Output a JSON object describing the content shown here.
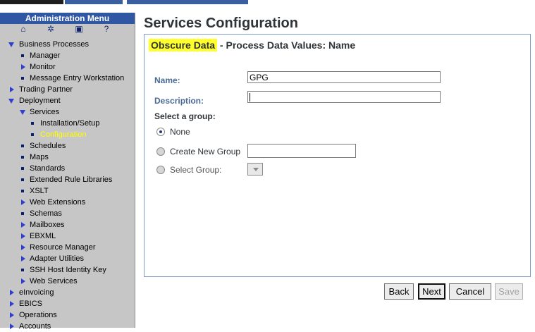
{
  "sidebar": {
    "title": "Administration Menu",
    "icons": [
      "home-icon",
      "globe-icon",
      "save-icon",
      "help-icon"
    ],
    "tree": [
      {
        "label": "Business Processes",
        "level": 0,
        "marker": "arrow-d"
      },
      {
        "label": "Manager",
        "level": 1,
        "marker": "bullet"
      },
      {
        "label": "Monitor",
        "level": 1,
        "marker": "arrow-r"
      },
      {
        "label": "Message Entry Workstation",
        "level": 1,
        "marker": "bullet"
      },
      {
        "label": "Trading Partner",
        "level": 0,
        "marker": "arrow-r"
      },
      {
        "label": "Deployment",
        "level": 0,
        "marker": "arrow-d"
      },
      {
        "label": "Services",
        "level": 1,
        "marker": "arrow-d"
      },
      {
        "label": "Installation/Setup",
        "level": 2,
        "marker": "bullet"
      },
      {
        "label": "Configuration",
        "level": 2,
        "marker": "bullet",
        "selected": true
      },
      {
        "label": "Schedules",
        "level": 1,
        "marker": "bullet"
      },
      {
        "label": "Maps",
        "level": 1,
        "marker": "bullet"
      },
      {
        "label": "Standards",
        "level": 1,
        "marker": "bullet"
      },
      {
        "label": "Extended Rule Libraries",
        "level": 1,
        "marker": "bullet"
      },
      {
        "label": "XSLT",
        "level": 1,
        "marker": "bullet"
      },
      {
        "label": "Web Extensions",
        "level": 1,
        "marker": "arrow-r"
      },
      {
        "label": "Schemas",
        "level": 1,
        "marker": "bullet"
      },
      {
        "label": "Mailboxes",
        "level": 1,
        "marker": "arrow-r"
      },
      {
        "label": "EBXML",
        "level": 1,
        "marker": "arrow-r"
      },
      {
        "label": "Resource Manager",
        "level": 1,
        "marker": "arrow-r"
      },
      {
        "label": "Adapter Utilities",
        "level": 1,
        "marker": "arrow-r"
      },
      {
        "label": "SSH Host Identity Key",
        "level": 1,
        "marker": "bullet"
      },
      {
        "label": "Web Services",
        "level": 1,
        "marker": "arrow-r"
      },
      {
        "label": "eInvoicing",
        "level": 0,
        "marker": "arrow-r"
      },
      {
        "label": "EBICS",
        "level": 0,
        "marker": "arrow-r"
      },
      {
        "label": "Operations",
        "level": 0,
        "marker": "arrow-r"
      },
      {
        "label": "Accounts",
        "level": 0,
        "marker": "arrow-r"
      }
    ]
  },
  "main": {
    "title": "Services Configuration",
    "panel": {
      "highlight": "Obscure Data",
      "heading_rest": " - Process Data Values: Name",
      "name_label": "Name:",
      "name_value": "GPG",
      "description_label": "Description:",
      "description_value": "",
      "select_group_label": "Select a group:",
      "radio_none": "None",
      "radio_create": "Create New Group",
      "radio_select": "Select Group:",
      "new_group_value": ""
    },
    "buttons": {
      "back": "Back",
      "next": "Next",
      "cancel": "Cancel",
      "save": "Save"
    }
  },
  "colors": {
    "menu_header": "#2f57a4",
    "sidebar_bg": "#c6c6c6",
    "selected_item": "#ffff00",
    "highlight": "#ffff2e",
    "label_blue": "#4a6a95",
    "panel_border": "#7f9bc8"
  }
}
